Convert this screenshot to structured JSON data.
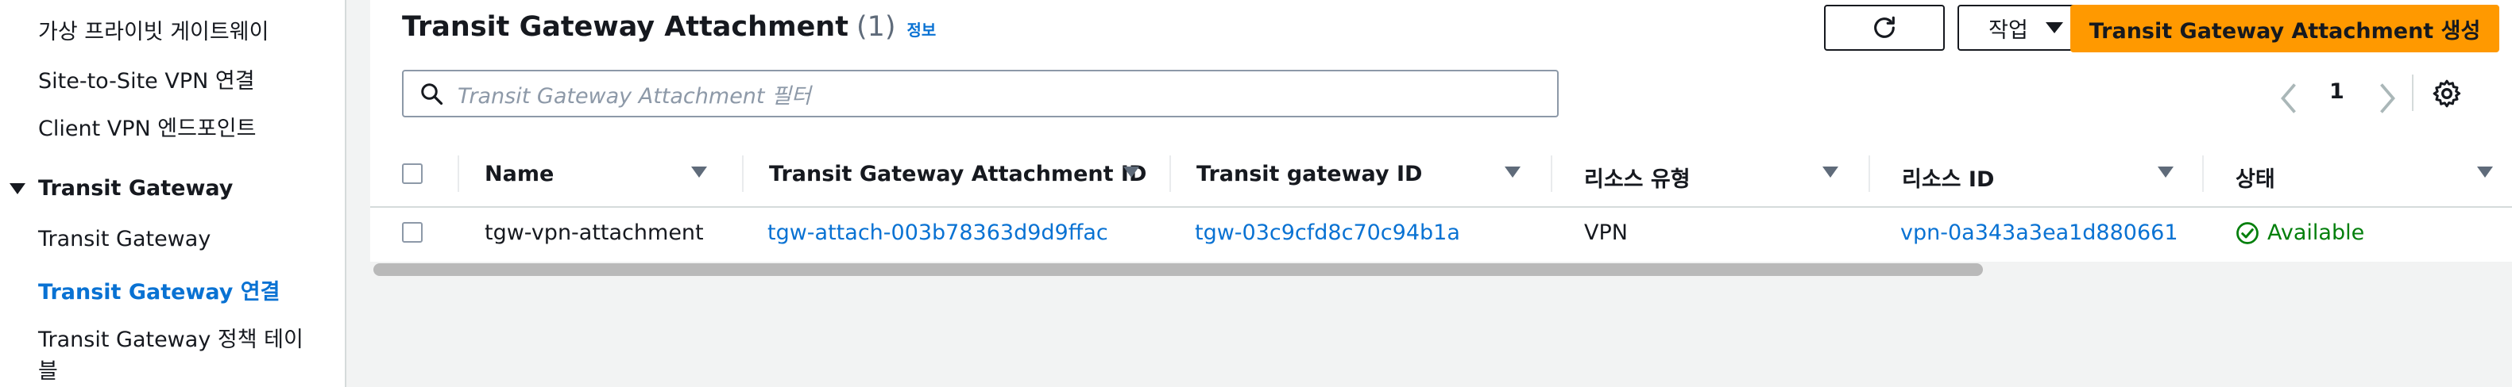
{
  "sidebar": {
    "items_top": [
      {
        "label": "가상 프라이빗 게이트웨이"
      },
      {
        "label": "Site-to-Site VPN 연결"
      },
      {
        "label": "Client VPN 엔드포인트"
      }
    ],
    "section": {
      "label": "Transit Gateway"
    },
    "items_section": [
      {
        "label": "Transit Gateway",
        "active": false
      },
      {
        "label": "Transit Gateway 연결",
        "active": true
      },
      {
        "label": "Transit Gateway 정책 테이"
      },
      {
        "label": "블"
      }
    ]
  },
  "header": {
    "title": "Transit Gateway Attachment",
    "count": "(1)",
    "info_link": "정보",
    "refresh_icon": "refresh-icon",
    "actions_label": "작업",
    "create_label": "Transit Gateway Attachment 생성"
  },
  "search": {
    "placeholder": "Transit Gateway Attachment 필터",
    "icon": "search-icon"
  },
  "pagination": {
    "current_page": "1"
  },
  "table": {
    "columns": [
      "Name",
      "Transit Gateway Attachment ID",
      "Transit gateway ID",
      "리소스 유형",
      "리소스 ID",
      "상태"
    ],
    "rows": [
      {
        "name": "tgw-vpn-attachment",
        "attachment_id": "tgw-attach-003b78363d9d9ffac",
        "tgw_id": "tgw-03c9cfd8c70c94b1a",
        "resource_type": "VPN",
        "resource_id": "vpn-0a343a3ea1d880661",
        "status": "Available"
      }
    ]
  },
  "colors": {
    "accent": "#0972d3",
    "primary_button": "#ff9900",
    "status_ok": "#037f0c"
  }
}
